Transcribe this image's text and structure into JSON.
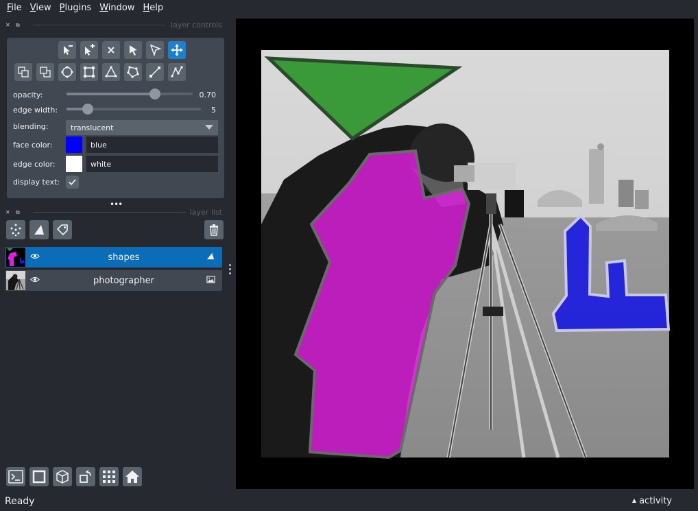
{
  "menu": [
    {
      "label": "File",
      "mnemonic": "F",
      "rest": "ile"
    },
    {
      "label": "View",
      "mnemonic": "V",
      "rest": "iew"
    },
    {
      "label": "Plugins",
      "mnemonic": "P",
      "rest": "lugins"
    },
    {
      "label": "Window",
      "mnemonic": "W",
      "rest": "indow"
    },
    {
      "label": "Help",
      "mnemonic": "H",
      "rest": "elp"
    }
  ],
  "layer_controls": {
    "title": "layer controls",
    "opacity_label": "opacity:",
    "opacity_value": "0.70",
    "opacity_level": 0.7,
    "edge_width_label": "edge width:",
    "edge_width_value": "5",
    "edge_width_level": 0.16,
    "blending_label": "blending:",
    "blending_value": "translucent",
    "face_color_label": "face color:",
    "face_color_value": "blue",
    "face_color_hex": "#0000ff",
    "edge_color_label": "edge color:",
    "edge_color_value": "white",
    "edge_color_hex": "#ffffff",
    "display_text_label": "display text:",
    "display_text_checked": true
  },
  "layer_list": {
    "title": "layer list",
    "layers": [
      {
        "name": "shapes",
        "selected": true,
        "visible": true,
        "type_icon": "shapes-layer-icon"
      },
      {
        "name": "photographer",
        "selected": false,
        "visible": true,
        "type_icon": "image-layer-icon"
      }
    ]
  },
  "status": {
    "text": "Ready",
    "activity": "activity"
  },
  "colors": {
    "accent": "#1d7fce",
    "selected_layer": "#0b6cb8",
    "panel": "#414851",
    "background": "#262930",
    "green_shape": "#3a9a3a",
    "magenta_shape": "#e020e0",
    "blue_shape": "#1818e0"
  }
}
